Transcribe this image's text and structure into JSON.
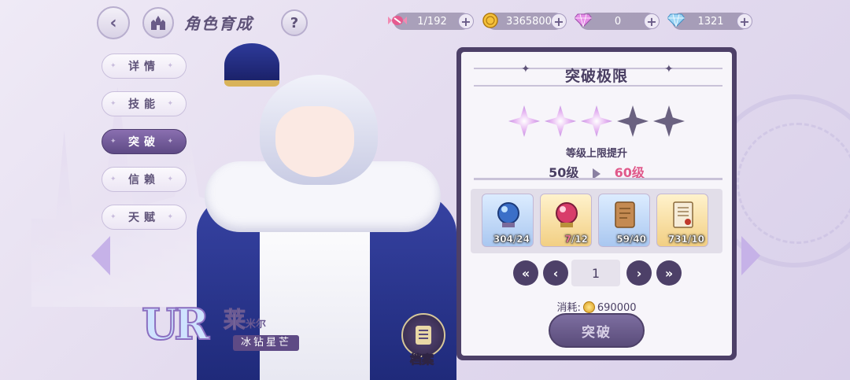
{
  "header": {
    "title": "角色育成",
    "back_icon": "chevron-left-icon",
    "home_icon": "castle-icon",
    "help_label": "?"
  },
  "resources": [
    {
      "icon": "candy-icon",
      "value": "1/192"
    },
    {
      "icon": "gold-coin-icon",
      "value": "3365800"
    },
    {
      "icon": "pink-gem-icon",
      "value": "0"
    },
    {
      "icon": "blue-diamond-icon",
      "value": "1321"
    }
  ],
  "menu": {
    "items": [
      {
        "label": "详情",
        "active": false
      },
      {
        "label": "技能",
        "active": false
      },
      {
        "label": "突破",
        "active": true
      },
      {
        "label": "信赖",
        "active": false
      },
      {
        "label": "天赋",
        "active": false
      }
    ]
  },
  "character": {
    "rarity": "UR",
    "name": "莱",
    "name_rest": "米尔",
    "title": "冰钻星芒",
    "archive_label": "档案"
  },
  "panel": {
    "title": "突破极限",
    "stars_lit": 3,
    "stars_total": 5,
    "level_up_label": "等级上限提升",
    "level_from": "50级",
    "level_to": "60级",
    "materials": [
      {
        "icon": "blue-orb-icon",
        "count": "304/24",
        "bg": "blue",
        "insufficient": false
      },
      {
        "icon": "red-orb-icon",
        "count": "7",
        "need": "/12",
        "bg": "gold",
        "insufficient": true
      },
      {
        "icon": "scroll-icon",
        "count": "59/40",
        "bg": "blue",
        "insufficient": false
      },
      {
        "icon": "document-scroll-icon",
        "count": "731/10",
        "bg": "gold",
        "insufficient": false
      }
    ],
    "pager": {
      "value": "1"
    },
    "cost_label": "消耗:",
    "cost_value": "690000",
    "button_label": "突破"
  },
  "colors": {
    "accent": "#4d4068",
    "active_tab": "#5e4a85",
    "highlight_level": "#e0598a",
    "arrow": "#c6b2e8"
  }
}
